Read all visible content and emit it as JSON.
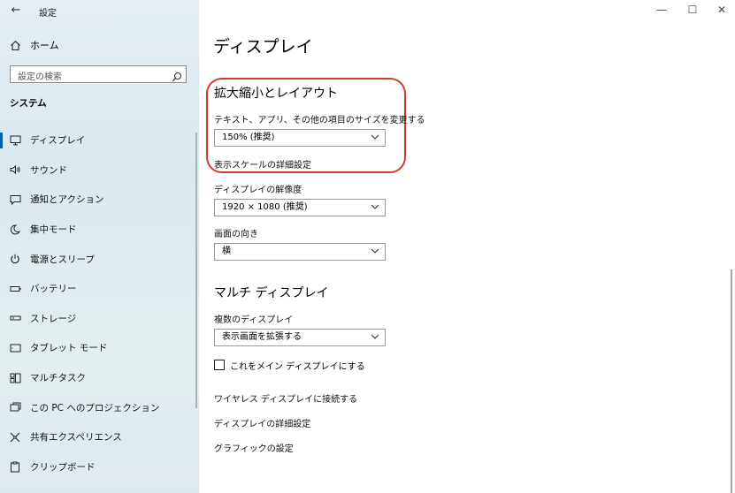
{
  "app": {
    "title": "設定",
    "back_glyph": "←"
  },
  "window_controls": {
    "minimize": "—",
    "maximize": "☐",
    "close": "✕"
  },
  "sidebar": {
    "home_label": "ホーム",
    "search_placeholder": "設定の検索",
    "section_title": "システム",
    "items": [
      {
        "label": "ディスプレイ",
        "icon": "monitor-icon",
        "active": true
      },
      {
        "label": "サウンド",
        "icon": "speaker-icon"
      },
      {
        "label": "通知とアクション",
        "icon": "notification-icon"
      },
      {
        "label": "集中モード",
        "icon": "moon-icon"
      },
      {
        "label": "電源とスリープ",
        "icon": "power-icon"
      },
      {
        "label": "バッテリー",
        "icon": "battery-icon"
      },
      {
        "label": "ストレージ",
        "icon": "storage-icon"
      },
      {
        "label": "タブレット モード",
        "icon": "tablet-icon"
      },
      {
        "label": "マルチタスク",
        "icon": "multitask-icon"
      },
      {
        "label": "この PC へのプロジェクション",
        "icon": "projection-icon"
      },
      {
        "label": "共有エクスペリエンス",
        "icon": "share-icon"
      },
      {
        "label": "クリップボード",
        "icon": "clipboard-icon"
      }
    ]
  },
  "main": {
    "page_title": "ディスプレイ",
    "scale_section": {
      "heading": "拡大縮小とレイアウト",
      "size_label": "テキスト、アプリ、その他の項目のサイズを変更する",
      "size_value": "150% (推奨)",
      "advanced_link": "表示スケールの詳細設定"
    },
    "resolution": {
      "label": "ディスプレイの解像度",
      "value": "1920 × 1080 (推奨)"
    },
    "orientation": {
      "label": "画面の向き",
      "value": "横"
    },
    "multi_section": {
      "heading": "マルチ ディスプレイ",
      "label": "複数のディスプレイ",
      "value": "表示画面を拡張する",
      "checkbox_label": "これをメイン ディスプレイにする",
      "checkbox_checked": false
    },
    "links": {
      "wireless": "ワイヤレス ディスプレイに接続する",
      "advanced": "ディスプレイの詳細設定",
      "graphics": "グラフィックの設定"
    }
  },
  "colors": {
    "accent": "#0063b1",
    "highlight": "#d43a2a"
  }
}
